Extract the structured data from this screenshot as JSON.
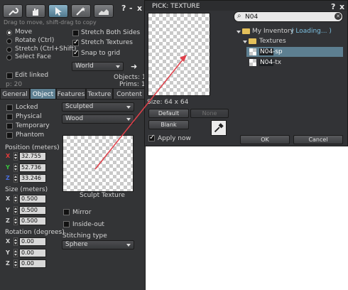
{
  "build": {
    "hint": "Drag to move, shift-drag to copy",
    "title_help": "?",
    "title_minimize": "-",
    "title_close": "x",
    "tools": [
      {
        "name": "wrench-icon",
        "active": false
      },
      {
        "name": "hand-icon",
        "active": false
      },
      {
        "name": "pointer-icon",
        "active": true
      },
      {
        "name": "magic-wand-icon",
        "active": false
      },
      {
        "name": "land-icon",
        "active": false
      }
    ],
    "edit_modes": [
      {
        "label": "Move",
        "selected": true
      },
      {
        "label": "Rotate (Ctrl)",
        "selected": false
      },
      {
        "label": "Stretch (Ctrl+Shift)",
        "selected": false
      },
      {
        "label": "Select Face",
        "selected": false
      }
    ],
    "options": [
      {
        "label": "Stretch Both Sides",
        "checked": false
      },
      {
        "label": "Stretch Textures",
        "checked": true
      },
      {
        "label": "Snap to grid",
        "checked": true
      }
    ],
    "ruler_mode": "World",
    "edit_linked": {
      "label": "Edit linked",
      "checked": false
    },
    "objects_count": "Objects: 1",
    "prims_count": "Prims: 1",
    "p_value": "p: 20",
    "tabs": [
      "General",
      "Object",
      "Features",
      "Texture",
      "Content"
    ],
    "active_tab": "Object",
    "flags": [
      {
        "label": "Locked",
        "checked": false
      },
      {
        "label": "Physical",
        "checked": false
      },
      {
        "label": "Temporary",
        "checked": false
      },
      {
        "label": "Phantom",
        "checked": false
      }
    ],
    "prim_type": "Sculpted",
    "material": "Wood",
    "position_label": "Position (meters)",
    "position": {
      "x": "32.755",
      "y": "52.736",
      "z": "33.246"
    },
    "size_label": "Size (meters)",
    "size": {
      "x": "0.500",
      "y": "0.500",
      "z": "0.500"
    },
    "rotation_label": "Rotation (degrees)",
    "rotation": {
      "x": "0.00",
      "y": "0.00",
      "z": "0.00"
    },
    "axis_labels": {
      "x": "X",
      "y": "Y",
      "z": "Z"
    },
    "axis_colors": {
      "x": "#e43a3a",
      "y": "#39c43f",
      "z": "#4a6fe0"
    },
    "sculpt_texture_label": "Sculpt Texture",
    "mirror": {
      "label": "Mirror",
      "checked": false
    },
    "inside_out": {
      "label": "Inside-out",
      "checked": false
    },
    "stitching_label": "Stitching type",
    "stitching_type": "Sphere"
  },
  "picker": {
    "title": "PICK: TEXTURE",
    "title_help": "?",
    "title_close": "x",
    "search_value": "N04",
    "size_text": "Size: 64 x 64",
    "default_button": "Default",
    "none_button": "None",
    "blank_button": "Blank",
    "apply_now": {
      "label": "Apply now",
      "checked": true
    },
    "ok_button": "OK",
    "cancel_button": "Cancel",
    "tree": {
      "inventory_label": "My Inventory",
      "loading_text": "( Loading... )",
      "folder": "Textures",
      "items": [
        {
          "match": "N04",
          "rest": "-sp",
          "selected": true
        },
        {
          "match": "N04",
          "rest": "-tx",
          "selected": false
        }
      ]
    }
  },
  "colors": {
    "panel_bg": "#333436",
    "accent_selected": "#5d7f91",
    "arrow": "#e0404a",
    "loading_text": "#7cc0e0"
  }
}
